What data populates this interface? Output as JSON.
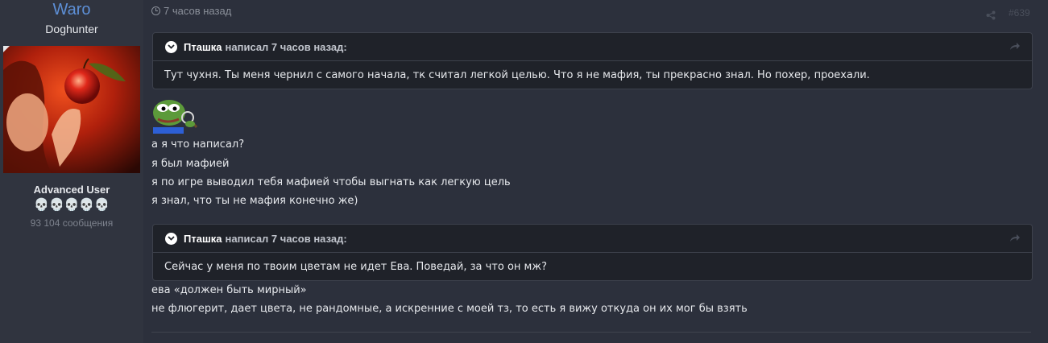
{
  "profile": {
    "username": "Waro",
    "title": "Doghunter",
    "banner": "Advanced User",
    "skulls": "💀💀💀💀💀",
    "message_count": "93 104 сообщения"
  },
  "post": {
    "time": "7 часов назад",
    "number": "#639",
    "quotes": [
      {
        "author": "Пташка",
        "suffix": "написал 7 часов назад:",
        "text": "Тут чухня. Ты меня чернил с самого начала, тк считал легкой целью. Что я не мафия, ты прекрасно знал. Но похер, проехали."
      },
      {
        "author": "Пташка",
        "suffix": "написал 7 часов назад:",
        "text": "Сейчас у меня по твоим цветам не идет Ева. Поведай, за что он мж?"
      }
    ],
    "reply1": [
      "а я что написал?",
      "я был мафией",
      "я по игре выводил тебя мафией чтобы выгнать как легкую цель",
      "я знал, что ты не мафия конечно же)"
    ],
    "reply2": [
      "ева «должен быть мирный»",
      "не флюгерит, дает цвета, не рандомные, а искренние с моей тз, то есть я вижу откуда он их мог бы взять"
    ]
  },
  "icons": {
    "clock": "clock-icon",
    "share": "share-icon",
    "chevron": "chevron-down-icon",
    "goto": "goto-arrow-icon"
  }
}
